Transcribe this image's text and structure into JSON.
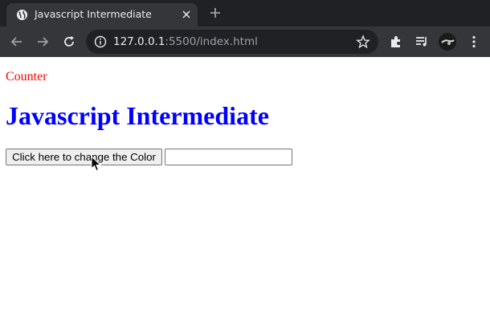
{
  "browser": {
    "tab": {
      "title": "Javascript Intermediate"
    },
    "address": {
      "host": "127.0.0.1",
      "path": ":5500/index.html"
    }
  },
  "page": {
    "counter_text": "Counter",
    "heading": "Javascript Intermediate",
    "color_button_label": "Click here to change the Color",
    "text_input_value": ""
  },
  "colors": {
    "counter": "#ff0000",
    "heading": "#0000ff",
    "tabstrip_bg": "#202124",
    "toolbar_bg": "#35363a"
  },
  "icons": [
    "globe-icon",
    "close-icon",
    "new-tab-icon",
    "back-arrow-icon",
    "forward-arrow-icon",
    "reload-icon",
    "info-icon",
    "star-icon",
    "extensions-icon",
    "reading-list-icon",
    "profile-avatar",
    "mouse-cursor"
  ]
}
